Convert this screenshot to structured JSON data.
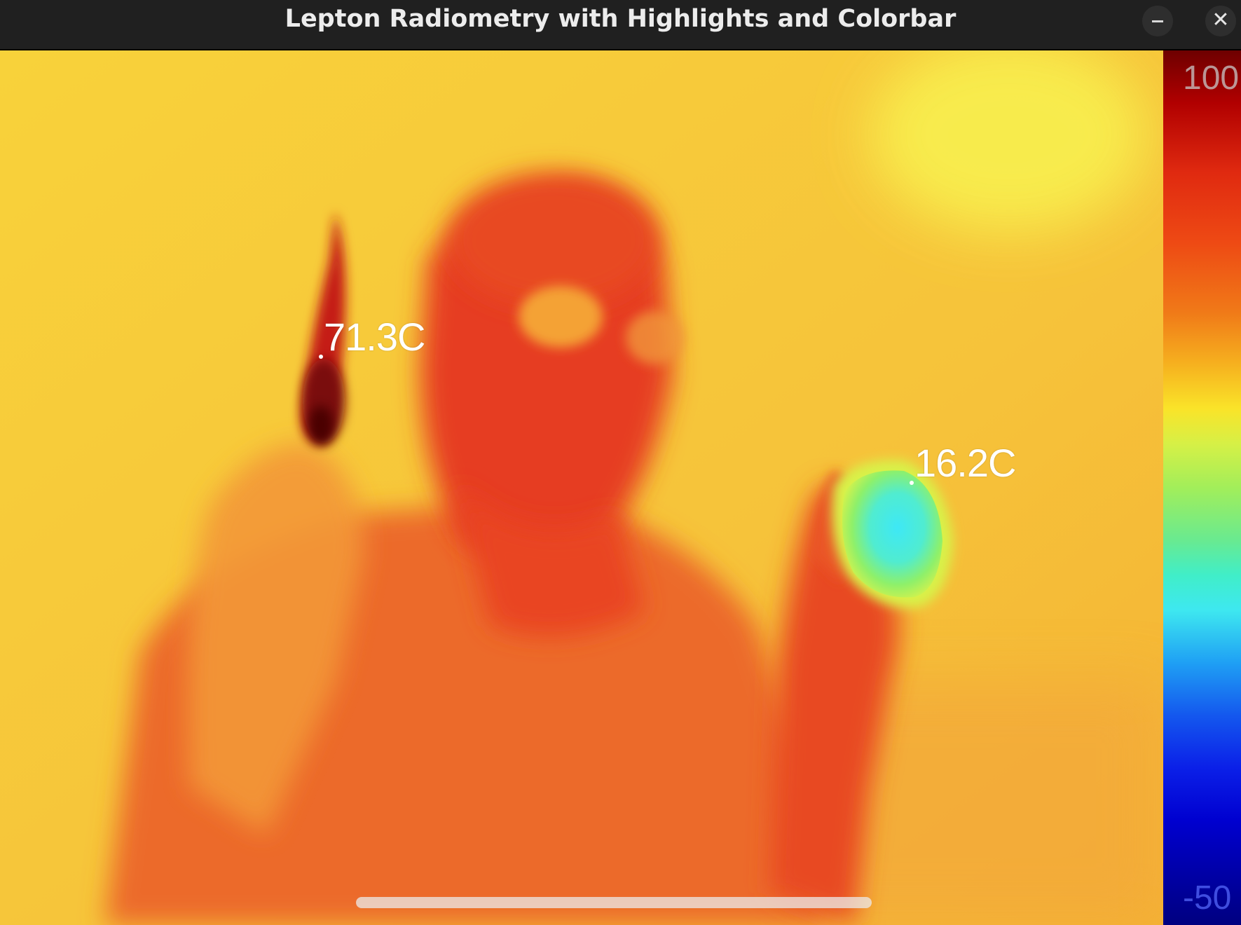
{
  "window": {
    "title": "Lepton Radiometry with Highlights and Colorbar",
    "minimize_glyph": "–",
    "close_glyph": "✕"
  },
  "highlights": {
    "hot_label": "71.3C",
    "cold_label": "16.2C"
  },
  "colorbar": {
    "max_label": "100",
    "min_label": "-50",
    "palette": "jet",
    "top_color": "#6e0000",
    "bottom_color": "#000080"
  },
  "colors": {
    "background_hot": "#e8441c",
    "background_warm": "#f6c43a",
    "cold_spot": "#3ee8f0",
    "titlebar": "#202020"
  }
}
